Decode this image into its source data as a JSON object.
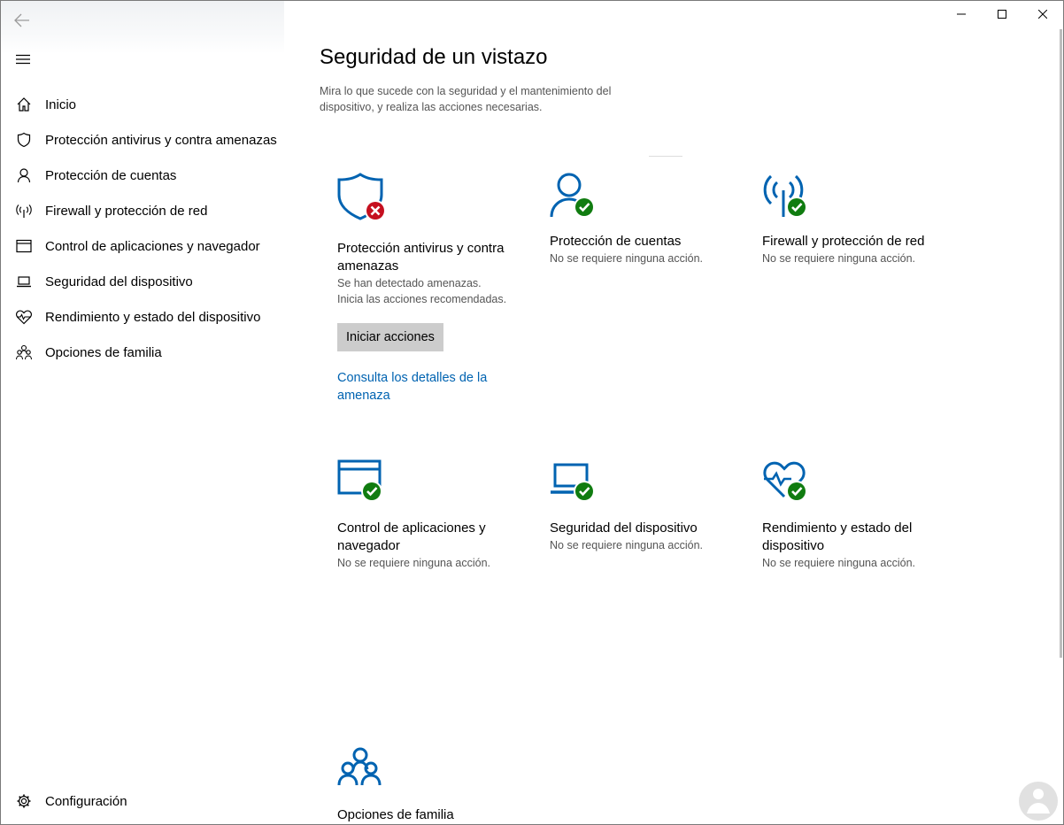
{
  "window": {
    "controls": {
      "minimize": "minimize-icon",
      "maximize": "maximize-icon",
      "close": "close-icon"
    }
  },
  "sidebar": {
    "items": [
      {
        "label": "Inicio",
        "icon": "home-icon"
      },
      {
        "label": "Protección antivirus y contra amenazas",
        "icon": "shield-icon"
      },
      {
        "label": "Protección de cuentas",
        "icon": "person-icon"
      },
      {
        "label": "Firewall y protección de red",
        "icon": "wifi-antenna-icon"
      },
      {
        "label": "Control de aplicaciones y navegador",
        "icon": "app-browser-icon"
      },
      {
        "label": "Seguridad del dispositivo",
        "icon": "laptop-icon"
      },
      {
        "label": "Rendimiento y estado del dispositivo",
        "icon": "heart-icon"
      },
      {
        "label": "Opciones de familia",
        "icon": "family-icon"
      }
    ],
    "settings": {
      "label": "Configuración",
      "icon": "gear-icon"
    }
  },
  "main": {
    "title": "Seguridad de un vistazo",
    "description": "Mira lo que sucede con la seguridad y el mantenimiento del dispositivo, y realiza las acciones necesarias.",
    "tiles": [
      {
        "title": "Protección antivirus y contra amenazas",
        "status_lines": [
          "Se han detectado amenazas.",
          "Inicia las acciones recomendadas."
        ],
        "button": "Iniciar acciones",
        "link": "Consulta los detalles de la amenaza",
        "state": "error"
      },
      {
        "title": "Protección de cuentas",
        "status": "No se requiere ninguna acción.",
        "state": "ok"
      },
      {
        "title": "Firewall y protección de red",
        "status": "No se requiere ninguna acción.",
        "state": "ok"
      },
      {
        "title": "Control de aplicaciones y navegador",
        "status": "No se requiere ninguna acción.",
        "state": "ok"
      },
      {
        "title": "Seguridad del dispositivo",
        "status": "No se requiere ninguna acción.",
        "state": "ok"
      },
      {
        "title": "Rendimiento y estado del dispositivo",
        "status": "No se requiere ninguna acción.",
        "state": "ok"
      },
      {
        "title": "Opciones de familia"
      }
    ]
  },
  "colors": {
    "accent": "#0063b1",
    "ok": "#107c10",
    "error": "#c50f1f",
    "button_bg": "#cccccc"
  }
}
